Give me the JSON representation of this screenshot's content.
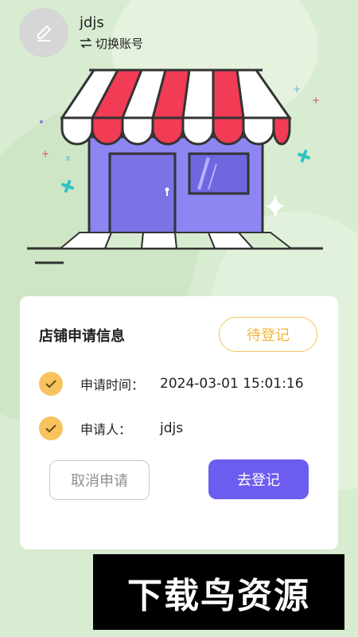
{
  "header": {
    "username": "jdjs",
    "switch_label": "切换账号",
    "avatar_icon": "pencil-icon",
    "switch_icon": "swap-arrows-icon"
  },
  "card": {
    "title": "店铺申请信息",
    "status": "待登记",
    "rows": [
      {
        "label": "申请时间：",
        "value": "2024-03-01 15:01:16"
      },
      {
        "label": "申请人：",
        "value": "jdjs"
      }
    ],
    "cancel_label": "取消申请",
    "register_label": "去登记"
  },
  "watermark": {
    "text": "下载鸟资源"
  },
  "colors": {
    "background": "#d8ecd1",
    "accent": "#6d5cf0",
    "status": "#f0b73b",
    "check": "#f7c35e"
  }
}
